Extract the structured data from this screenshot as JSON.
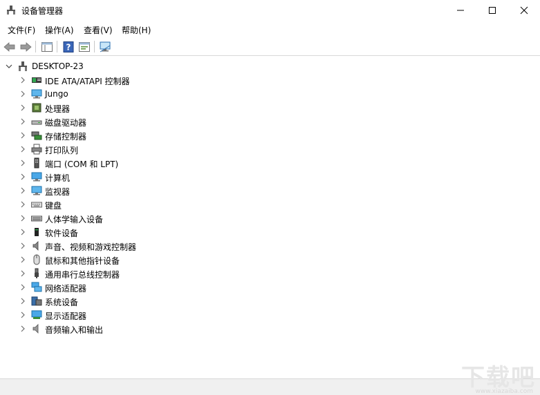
{
  "window": {
    "title": "设备管理器"
  },
  "menu": [
    {
      "label": "文件(F)"
    },
    {
      "label": "操作(A)"
    },
    {
      "label": "查看(V)"
    },
    {
      "label": "帮助(H)"
    }
  ],
  "tree": {
    "root": "DESKTOP-23",
    "items": [
      {
        "label": "IDE ATA/ATAPI 控制器",
        "icon": "ide-controller-icon"
      },
      {
        "label": "Jungo",
        "icon": "monitor-icon"
      },
      {
        "label": "处理器",
        "icon": "processor-icon"
      },
      {
        "label": "磁盘驱动器",
        "icon": "disk-drive-icon"
      },
      {
        "label": "存储控制器",
        "icon": "storage-controller-icon"
      },
      {
        "label": "打印队列",
        "icon": "printer-icon"
      },
      {
        "label": "端口 (COM 和 LPT)",
        "icon": "port-icon"
      },
      {
        "label": "计算机",
        "icon": "computer-icon"
      },
      {
        "label": "监视器",
        "icon": "monitor-icon"
      },
      {
        "label": "键盘",
        "icon": "keyboard-icon"
      },
      {
        "label": "人体学输入设备",
        "icon": "hid-icon"
      },
      {
        "label": "软件设备",
        "icon": "software-device-icon"
      },
      {
        "label": "声音、视频和游戏控制器",
        "icon": "speaker-icon"
      },
      {
        "label": "鼠标和其他指针设备",
        "icon": "mouse-icon"
      },
      {
        "label": "通用串行总线控制器",
        "icon": "usb-icon"
      },
      {
        "label": "网络适配器",
        "icon": "network-adapter-icon"
      },
      {
        "label": "系统设备",
        "icon": "system-device-icon"
      },
      {
        "label": "显示适配器",
        "icon": "display-adapter-icon"
      },
      {
        "label": "音频输入和输出",
        "icon": "audio-io-icon"
      }
    ]
  },
  "watermark": {
    "text": "下载吧",
    "sub": "www.xiazaiba.com"
  },
  "colors": {
    "accent": "#1a7fd4",
    "treeText": "#000000",
    "chevron": "#6b6b6b"
  }
}
